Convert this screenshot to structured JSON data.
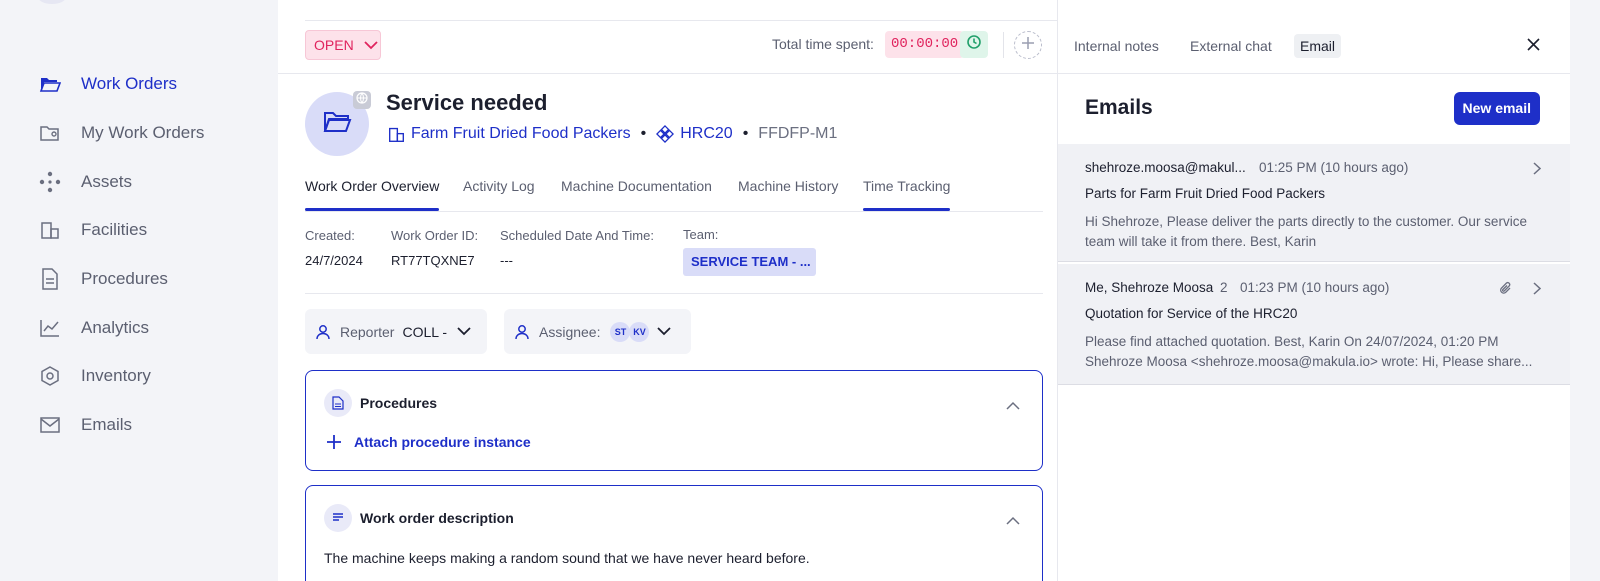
{
  "sidebar": {
    "items": [
      {
        "label": "Work Orders",
        "icon": "folder-icon",
        "active": true
      },
      {
        "label": "My Work Orders",
        "icon": "folder-user-icon",
        "active": false
      },
      {
        "label": "Assets",
        "icon": "assets-icon",
        "active": false
      },
      {
        "label": "Facilities",
        "icon": "building-icon",
        "active": false
      },
      {
        "label": "Procedures",
        "icon": "document-icon",
        "active": false
      },
      {
        "label": "Analytics",
        "icon": "chart-icon",
        "active": false
      },
      {
        "label": "Inventory",
        "icon": "inventory-icon",
        "active": false
      },
      {
        "label": "Emails",
        "icon": "mail-icon",
        "active": false
      }
    ]
  },
  "toolbar": {
    "status": "OPEN",
    "time_label": "Total time spent:",
    "time_value": "00:00:00"
  },
  "work_order": {
    "title": "Service needed",
    "facility": "Farm Fruit Dried Food Packers",
    "asset": "HRC20",
    "code": "FFDFP-M1"
  },
  "tabs": [
    "Work Order Overview",
    "Activity Log",
    "Machine Documentation",
    "Machine History",
    "Time Tracking"
  ],
  "details": {
    "created_label": "Created:",
    "created_value": "24/7/2024",
    "id_label": "Work Order ID:",
    "id_value": "RT77TQXNE7",
    "scheduled_label": "Scheduled Date And Time:",
    "scheduled_value": "---",
    "team_label": "Team:",
    "team_value": "SERVICE TEAM - ..."
  },
  "reporter": {
    "label": "Reporter",
    "value": "COLL -"
  },
  "assignee": {
    "label": "Assignee:",
    "initials": [
      "ST",
      "KV"
    ]
  },
  "procedures_card": {
    "title": "Procedures",
    "action": "Attach procedure instance"
  },
  "description_card": {
    "title": "Work order description",
    "text": "The machine keeps making a random sound that we have never heard before."
  },
  "panel": {
    "tabs": [
      "Internal notes",
      "External chat",
      "Email"
    ],
    "title": "Emails",
    "new_email": "New email",
    "emails": [
      {
        "from": "shehroze.moosa@makul...",
        "count": "",
        "time": "01:25 PM (10 hours ago)",
        "subject": "Parts for Farm Fruit Dried Food Packers",
        "preview": "Hi Shehroze, Please deliver the parts directly to the customer. Our service team will take it from there. Best, Karin"
      },
      {
        "from": "Me, Shehroze Moosa",
        "count": "2",
        "time": "01:23 PM (10 hours ago)",
        "subject": "Quotation for Service of the HRC20",
        "preview": "Please find attached quotation. Best, Karin On 24/07/2024, 01:20 PM Shehroze Moosa <shehroze.moosa@makula.io> wrote: Hi, Please share..."
      }
    ]
  },
  "colors": {
    "accent": "#1e2fc8",
    "status": "#e0245e",
    "status_bg": "#fde2ea"
  }
}
